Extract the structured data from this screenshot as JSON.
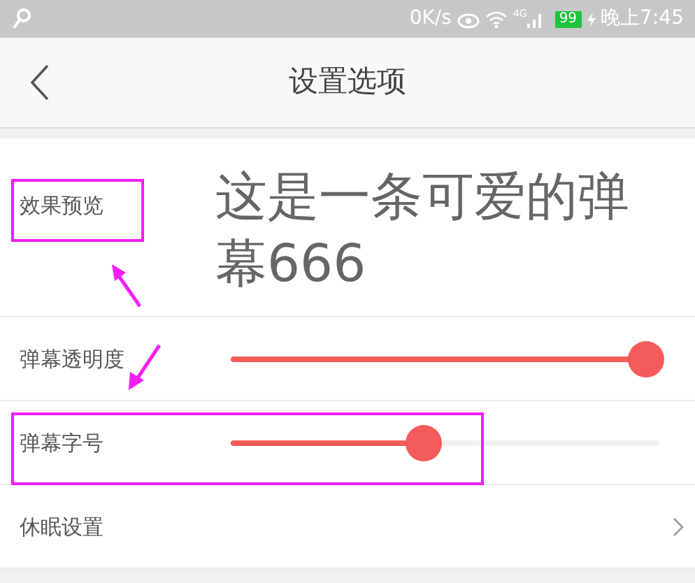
{
  "status_bar": {
    "speed": "0K/s",
    "network": "4G",
    "battery": "99",
    "time": "晚上7:45"
  },
  "header": {
    "title": "设置选项"
  },
  "preview": {
    "label": "效果预览",
    "sample": "这是一条可爱的弹幕666"
  },
  "settings": [
    {
      "kind": "slider",
      "label": "弹幕透明度",
      "level": 0.97
    },
    {
      "kind": "slider",
      "label": "弹幕字号",
      "level": 0.45
    },
    {
      "kind": "link",
      "label": "休眠设置"
    }
  ]
}
